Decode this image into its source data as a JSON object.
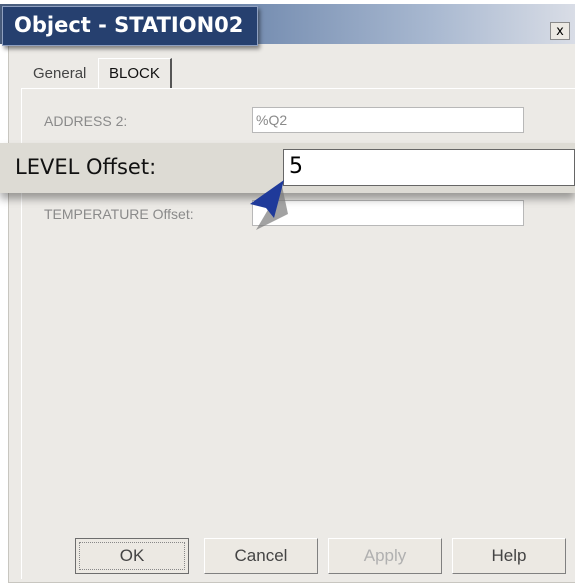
{
  "window": {
    "title": "Object - STATION02",
    "close_label": "x"
  },
  "tabs": [
    {
      "label": "General"
    },
    {
      "label": "BLOCK"
    }
  ],
  "fields": {
    "address2": {
      "label": "ADDRESS 2:",
      "value": "%Q2"
    },
    "level_offset": {
      "label": "LEVEL Offset:",
      "value": "5"
    },
    "temperature_offset": {
      "label": "TEMPERATURE Offset:",
      "value": ""
    }
  },
  "buttons": {
    "ok": "OK",
    "cancel": "Cancel",
    "apply": "Apply",
    "help": "Help"
  },
  "colors": {
    "title_bg": "#26406f",
    "cursor": "#1f3a9a"
  },
  "icons": {
    "cursor": "arrow-pointer-icon"
  }
}
